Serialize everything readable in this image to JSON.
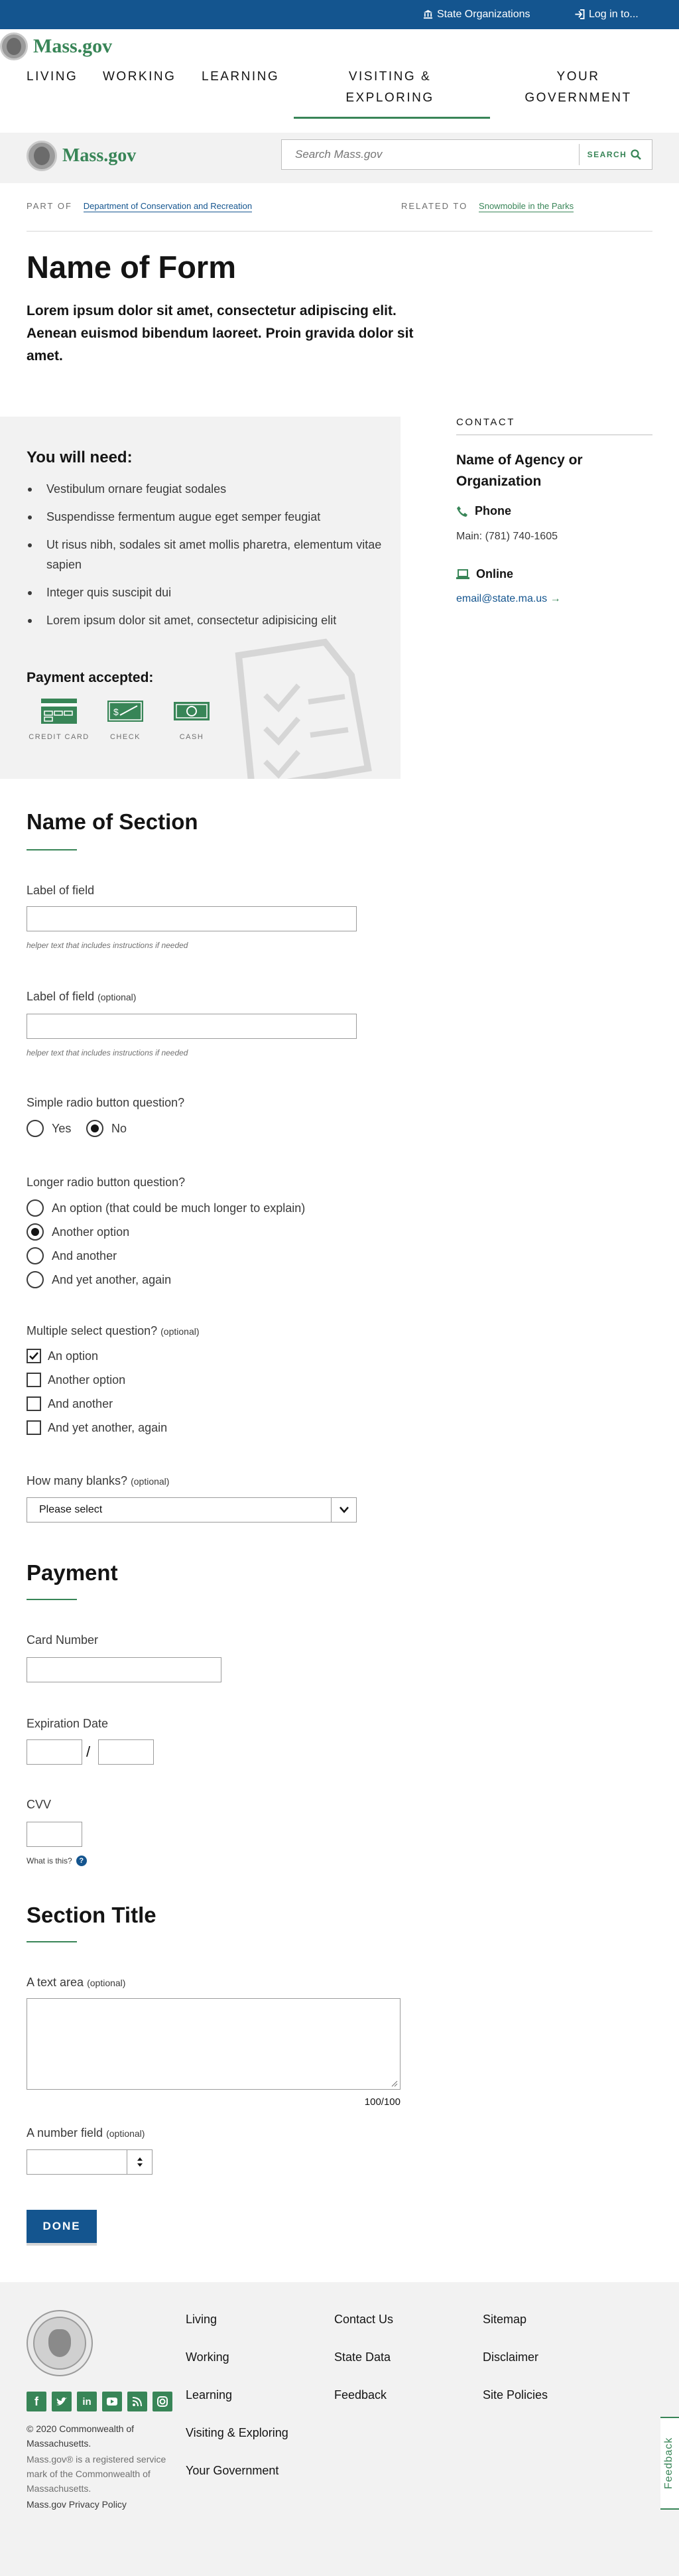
{
  "utility": {
    "state_orgs": "State Organizations",
    "login": "Log in to..."
  },
  "header": {
    "logo_text": "Mass.gov",
    "nav": [
      "LIVING",
      "WORKING",
      "LEARNING",
      "VISITING & EXPLORING",
      "YOUR GOVERNMENT"
    ],
    "search_placeholder": "Search Mass.gov",
    "search_button": "SEARCH"
  },
  "relationship": {
    "part_of_label": "PART OF",
    "part_of_link": "Department of Conservation and Recreation",
    "related_label": "RELATED TO",
    "related_link": "Snowmobile in the Parks"
  },
  "page": {
    "title": "Name of Form",
    "intro": "Lorem ipsum dolor sit amet, consectetur adipiscing elit. Aenean euismod bibendum laoreet. Proin gravida dolor sit amet."
  },
  "need": {
    "title": "You will need:",
    "items": [
      "Vestibulum ornare feugiat sodales",
      "Suspendisse fermentum augue eget semper feugiat",
      "Ut risus nibh, sodales sit amet mollis pharetra, elementum vitae sapien",
      "Integer quis suscipit dui",
      "Lorem ipsum dolor sit amet, consectetur adipisicing elit"
    ],
    "payment_title": "Payment accepted:",
    "payments": [
      "CREDIT CARD",
      "CHECK",
      "CASH"
    ]
  },
  "contact": {
    "heading": "CONTACT",
    "agency": "Name of Agency or Organization",
    "phone_label": "Phone",
    "main_label": "Main:",
    "phone": "(781) 740-1605",
    "online_label": "Online",
    "email": "email@state.ma.us"
  },
  "form": {
    "section1": "Name of Section",
    "field1_label": "Label of field",
    "field1_helper": "helper text that includes instructions if needed",
    "field2_label": "Label of field",
    "optional": "(optional)",
    "field2_helper": "helper text that includes instructions if needed",
    "simple_radio": {
      "question": "Simple radio button question?",
      "options": [
        "Yes",
        "No"
      ],
      "selected": "No"
    },
    "long_radio": {
      "question": "Longer radio button question?",
      "options": [
        "An option (that could be much longer to explain)",
        "Another option",
        "And another",
        "And yet another, again"
      ],
      "selected": "Another option"
    },
    "multi": {
      "question": "Multiple select question?",
      "options": [
        "An option",
        "Another option",
        "And another",
        "And yet another, again"
      ],
      "checked": [
        "An option"
      ]
    },
    "blanks_label": "How many blanks?",
    "blanks_value": "Please select",
    "payment_title": "Payment",
    "card_label": "Card Number",
    "exp_label": "Expiration Date",
    "exp_sep": "/",
    "cvv_label": "CVV",
    "cvv_help": "What is this?",
    "section3": "Section Title",
    "textarea_label": "A text area",
    "counter": "100/100",
    "number_label": "A number field",
    "done": "DONE"
  },
  "footer": {
    "col1": [
      "Living",
      "Working",
      "Learning",
      "Visiting & Exploring",
      "Your Government"
    ],
    "col2": [
      "Contact Us",
      "State Data",
      "Feedback"
    ],
    "col3": [
      "Sitemap",
      "Disclaimer",
      "Site Policies"
    ],
    "copyright": "© 2020 Commonwealth of Massachusetts.",
    "service_mark": "Mass.gov® is a registered service mark of the Commonwealth of Massachusetts.",
    "privacy": "Mass.gov Privacy Policy",
    "feedback_tab": "Feedback"
  },
  "colors": {
    "brand_blue": "#14558f",
    "brand_green": "#388557"
  }
}
